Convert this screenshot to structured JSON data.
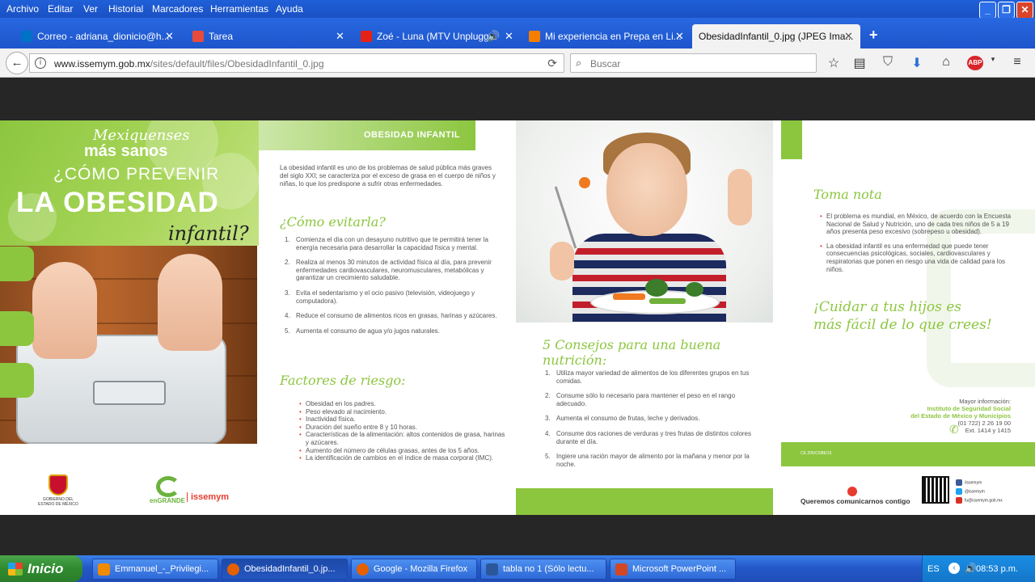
{
  "window": {
    "menu": [
      "Archivo",
      "Editar",
      "Ver",
      "Historial",
      "Marcadores",
      "Herramientas",
      "Ayuda"
    ],
    "controls": {
      "minimize": "_",
      "maximize": "❐",
      "close": "✕"
    }
  },
  "tabs": [
    {
      "label": "Correo - adriana_dionicio@h...",
      "icon": "outlook-icon",
      "color": "#0072c6"
    },
    {
      "label": "Tarea",
      "icon": "drive-icon",
      "color": "#e84b3c"
    },
    {
      "label": "Zoé - Luna (MTV Unplugg...",
      "icon": "youtube-icon",
      "color": "#e62117"
    },
    {
      "label": "Mi experiencia en Prepa en Li...",
      "icon": "blogger-icon",
      "color": "#f57d00"
    },
    {
      "label": "ObesidadInfantil_0.jpg (JPEG Ima...",
      "icon": "image-icon",
      "color": "#9aa0a6"
    }
  ],
  "new_tab_label": "+",
  "toolbar": {
    "back": "←",
    "url_domain": "www.issemym.gob.mx",
    "url_path": "/sites/default/files/ObesidadInfantil_0.jpg",
    "reload": "⟳",
    "search_placeholder": "Buscar"
  },
  "brochure": {
    "cover": {
      "line1": "Mexiquenses",
      "line2": "más sanos",
      "line3": "¿CÓMO PREVENIR",
      "line4": "LA OBESIDAD",
      "line5": "infantil?",
      "logo_state": "GOBIERNO DEL ESTADO DE MÉXICO",
      "logo_engrande": "enGRANDE",
      "logo_issemym": "issemym"
    },
    "panel2": {
      "header": "OBESIDAD INFANTIL",
      "intro": "La obesidad infantil es uno de los problemas de salud pública más graves del siglo XXI; se caracteriza por el exceso de grasa en el cuerpo de niños y niñas, lo que los predispone a sufrir otras enfermedades.",
      "heading1": "¿Cómo evitarla?",
      "steps": [
        "Comienza el día con un desayuno nutritivo que te permitirá tener la energía necesaria para desarrollar la capacidad física y mental.",
        "Realiza al menos 30 minutos de actividad física al día, para prevenir enfermedades cardiovasculares, neuromusculares, metabólicas y garantizar un crecimiento saludable.",
        "Evita el sedentarismo y el ocio pasivo (televisión, videojuego y computadora).",
        "Reduce el consumo de alimentos ricos en grasas, harinas y azúcares.",
        "Aumenta el consumo de agua y/o jugos naturales."
      ],
      "heading2": "Factores de riesgo:",
      "risks": [
        "Obesidad en los padres.",
        "Peso elevado al nacimiento.",
        "Inactividad física.",
        "Duración del sueño entre 8 y 10 horas.",
        "Características de la alimentación: altos contenidos de grasa, harinas y azúcares.",
        "Aumento del número de células grasas, antes de los 5 años.",
        "La identificación de cambios en el índice de masa corporal (IMC)."
      ]
    },
    "panel3": {
      "heading": "5 Consejos para una buena nutrición:",
      "tips": [
        "Utiliza mayor variedad de alimentos de los diferentes grupos en tus comidas.",
        "Consume sólo lo necesario para mantener el peso en el rango adecuado.",
        "Aumenta el consumo de frutas, leche y derivados.",
        "Consume dos raciones de verduras y tres frutas de distintos colores durante el día.",
        "Ingiere una ración mayor de alimento por la mañana y menor por la noche."
      ]
    },
    "panel4": {
      "heading": "Toma nota",
      "notes": [
        "El problema es mundial, en México, de acuerdo con la Encuesta Nacional de Salud y Nutrición, uno de cada tres niños de 5 a 19 años presenta peso excesivo (sobrepeso u obesidad).",
        "La obesidad infantil es una enfermedad que puede tener consecuencias psicológicas, sociales, cardiovasculares y respiratorias que ponen en riesgo una vida de calidad para los niños."
      ],
      "slogan_line1": "¡Cuidar a tus hijos es",
      "slogan_line2": "más fácil de lo que crees!",
      "info_label": "Mayor información:",
      "inst_line1": "Instituto de Seguridad Social",
      "inst_line2": "del Estado de México y Municipios",
      "phone": "(01 722) 2 26 19 00",
      "ext": "Ext. 1414 y 1415",
      "code": "CE 205/C/085/15",
      "contact": "Queremos comunicarnos contigo",
      "social": [
        "/issemym",
        "@issemym",
        "fu@issemym.gob.mx"
      ]
    }
  },
  "taskbar": {
    "start": "Inicio",
    "tasks": [
      {
        "label": "Emmanuel_-_Privilegi...",
        "icon": "vlc-icon",
        "color": "#f08a00"
      },
      {
        "label": "ObesidadInfantil_0.jp...",
        "icon": "firefox-icon",
        "color": "#e66000"
      },
      {
        "label": "Google - Mozilla Firefox",
        "icon": "firefox-icon",
        "color": "#e66000"
      },
      {
        "label": "tabla no 1 (Sólo lectu...",
        "icon": "word-icon",
        "color": "#2b579a"
      },
      {
        "label": "Microsoft PowerPoint ...",
        "icon": "powerpoint-icon",
        "color": "#d24726"
      }
    ],
    "lang": "ES",
    "clock": "08:53 p.m."
  }
}
